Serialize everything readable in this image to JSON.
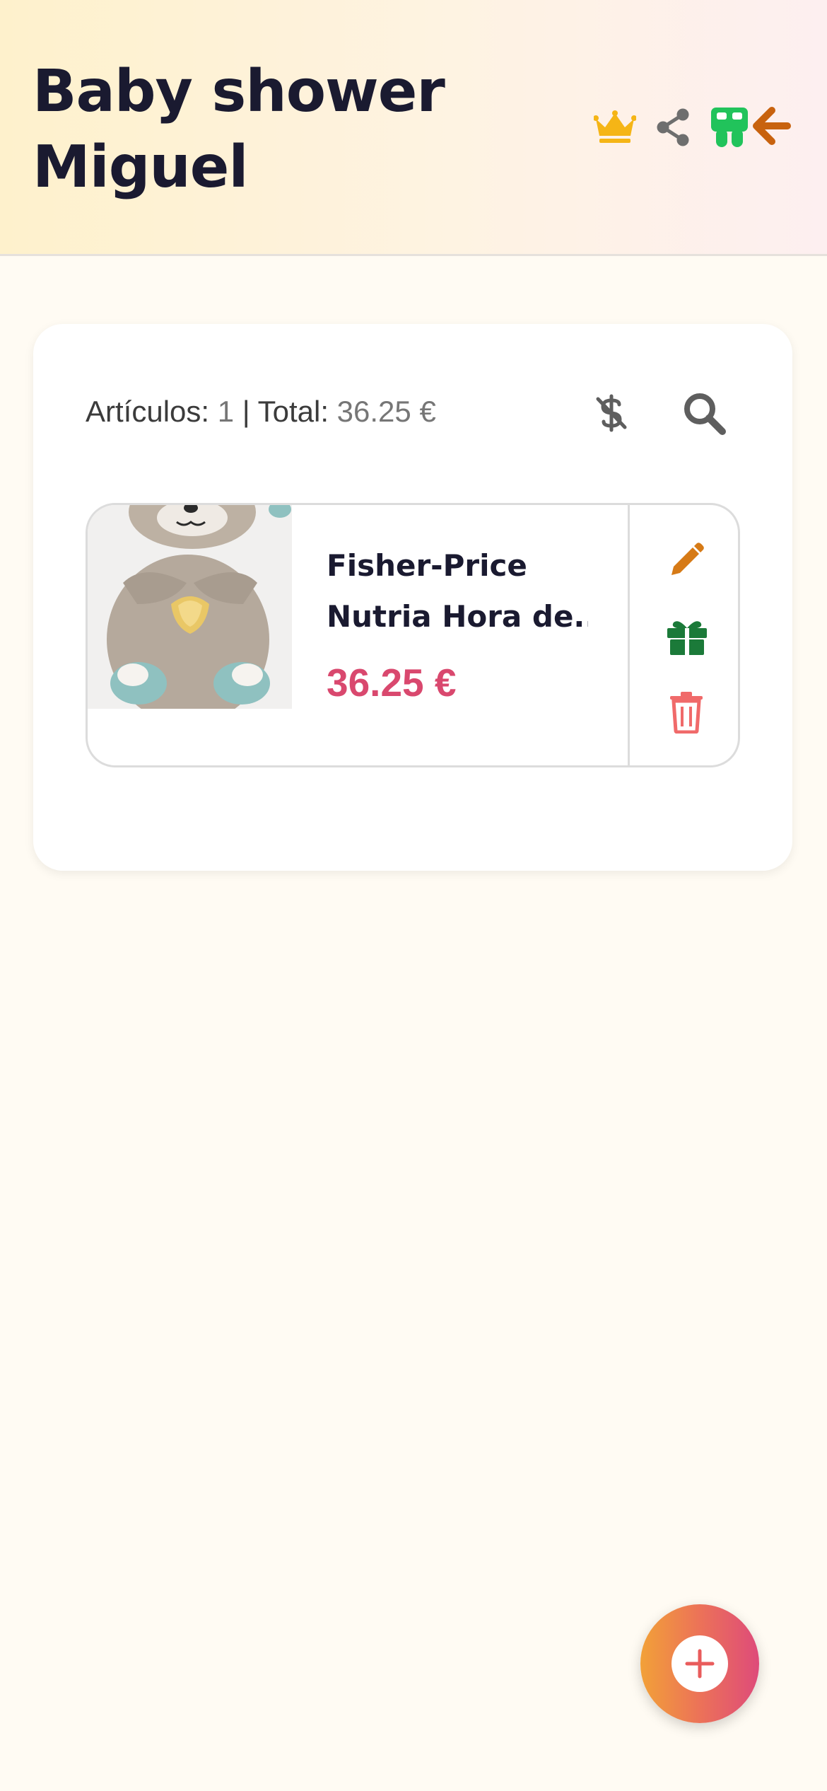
{
  "header": {
    "title_line1": "Baby shower",
    "title_line2": "Miguel",
    "icons": [
      "crown-icon",
      "share-icon",
      "app-logo-icon",
      "back-arrow-icon"
    ],
    "colors": {
      "crown": "#F5B516",
      "share": "#6E6E6E",
      "logo": "#21C35B",
      "back": "#C8620E"
    }
  },
  "summary": {
    "items_label": "Artículos:",
    "items_count": "1",
    "separator": "|",
    "total_label": "Total:",
    "total_value": "36.25 €",
    "icons": [
      "hide-price-icon",
      "search-icon"
    ]
  },
  "items": [
    {
      "name_line1": "Fisher-Price",
      "name_line2": "Nutria Hora de...",
      "price": "36.25 €",
      "image": "plush-otter-toy",
      "actions": [
        "edit-icon",
        "gift-icon",
        "delete-icon"
      ],
      "action_colors": {
        "edit": "#D67A16",
        "gift": "#1B7A39",
        "delete": "#F06A6A"
      }
    }
  ],
  "fab": {
    "icon": "plus-icon",
    "gradient": [
      "#F2A138",
      "#DE4B7A"
    ]
  }
}
